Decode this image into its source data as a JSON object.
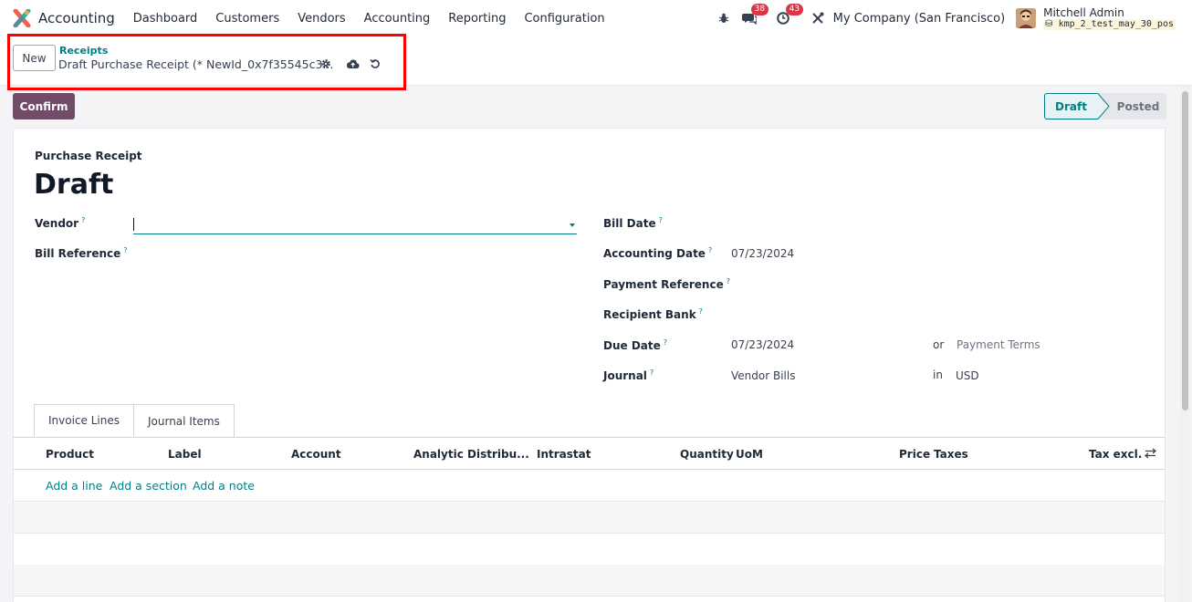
{
  "app": {
    "name": "Accounting",
    "menu": [
      "Dashboard",
      "Customers",
      "Vendors",
      "Accounting",
      "Reporting",
      "Configuration"
    ]
  },
  "systray": {
    "messages_count": "38",
    "activities_count": "43",
    "company": "My Company (San Francisco)",
    "user_name": "Mitchell Admin",
    "database": "kmp_2_test_may_30_pos"
  },
  "control_panel": {
    "new_label": "New",
    "breadcrumb_parent": "Receipts",
    "breadcrumb_current": "Draft Purchase Receipt (* NewId_0x7f35545c3..."
  },
  "actions": {
    "confirm_label": "Confirm"
  },
  "status": {
    "stages": [
      "Draft",
      "Posted"
    ],
    "current": "Draft"
  },
  "form": {
    "doc_type": "Purchase Receipt",
    "title": "Draft",
    "vendor_label": "Vendor",
    "vendor_value": "",
    "bill_reference_label": "Bill Reference",
    "bill_date_label": "Bill Date",
    "accounting_date_label": "Accounting Date",
    "accounting_date_value": "07/23/2024",
    "payment_reference_label": "Payment Reference",
    "recipient_bank_label": "Recipient Bank",
    "due_date_label": "Due Date",
    "due_date_value": "07/23/2024",
    "or_label": "or",
    "payment_terms_placeholder": "Payment Terms",
    "journal_label": "Journal",
    "journal_value": "Vendor Bills",
    "in_label": "in",
    "currency_value": "USD",
    "help_mark": "?"
  },
  "tabs": [
    "Invoice Lines",
    "Journal Items"
  ],
  "table": {
    "columns": [
      "Product",
      "Label",
      "Account",
      "Analytic Distribu...",
      "Intrastat",
      "Quantity",
      "UoM",
      "Price",
      "Taxes",
      "Tax excl."
    ],
    "add_line": "Add a line",
    "add_section": "Add a section",
    "add_note": "Add a note"
  }
}
